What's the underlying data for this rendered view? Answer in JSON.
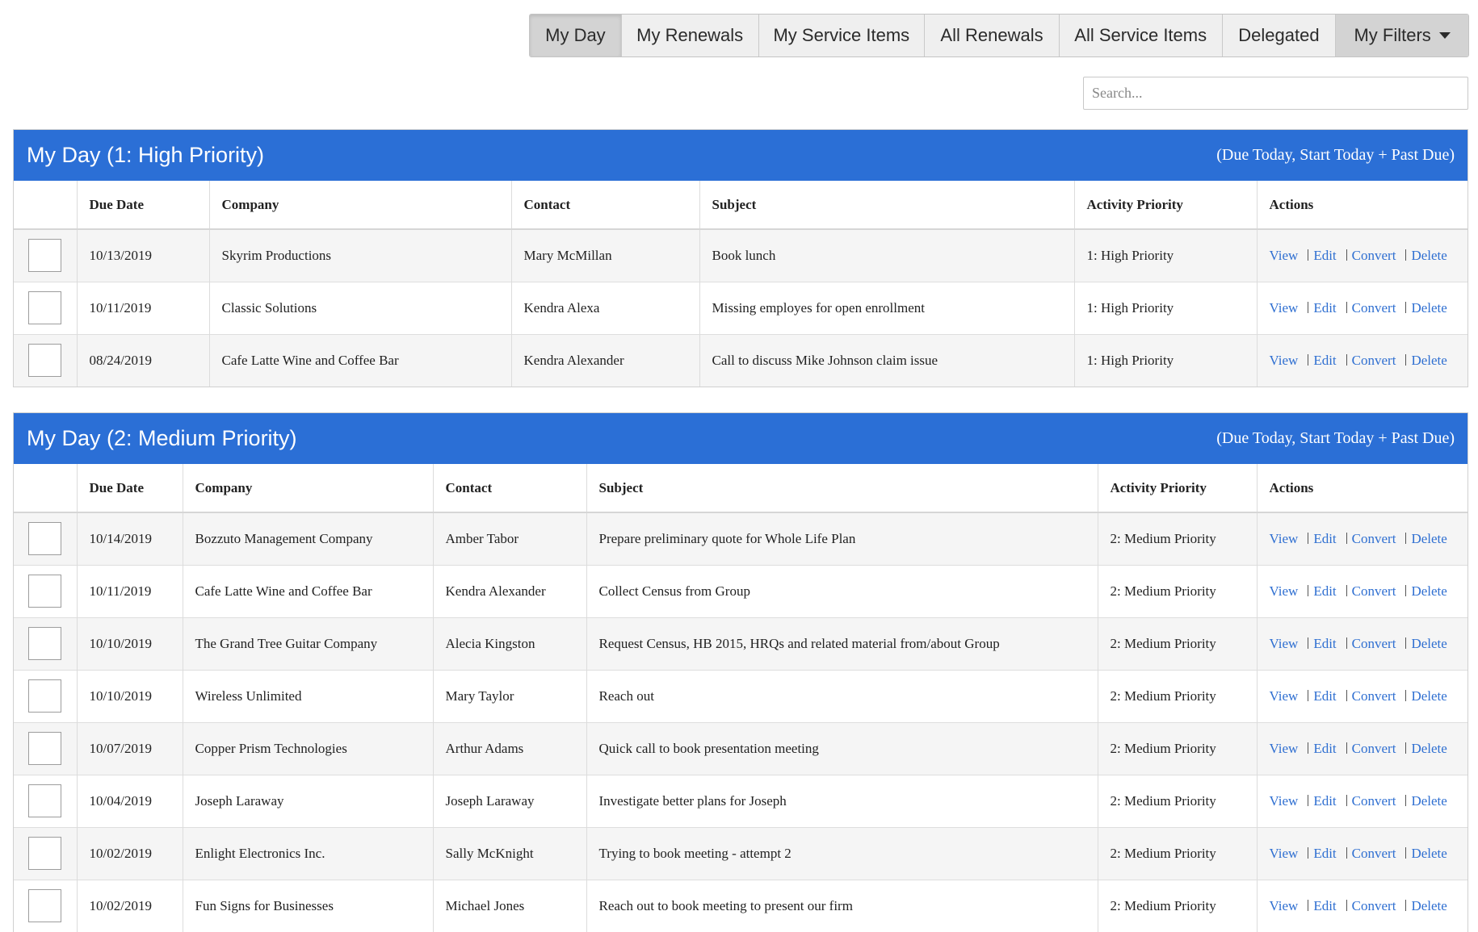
{
  "tabs": [
    {
      "label": "My Day",
      "active": true
    },
    {
      "label": "My Renewals",
      "active": false
    },
    {
      "label": "My Service Items",
      "active": false
    },
    {
      "label": "All Renewals",
      "active": false
    },
    {
      "label": "All Service Items",
      "active": false
    },
    {
      "label": "Delegated",
      "active": false
    },
    {
      "label": "My Filters",
      "active": false
    }
  ],
  "search": {
    "placeholder": "Search...",
    "value": ""
  },
  "columns": {
    "due_date": "Due Date",
    "company": "Company",
    "contact": "Contact",
    "subject": "Subject",
    "priority": "Activity Priority",
    "actions": "Actions"
  },
  "actions": {
    "view": "View",
    "edit": "Edit",
    "convert": "Convert",
    "delete": "Delete"
  },
  "sections": [
    {
      "title": "My Day (1: High Priority)",
      "note": "(Due Today, Start Today + Past Due)",
      "rows": [
        {
          "due_date": "10/13/2019",
          "company": "Skyrim Productions",
          "contact": "Mary McMillan",
          "subject": "Book lunch",
          "priority": "1: High Priority"
        },
        {
          "due_date": "10/11/2019",
          "company": "Classic Solutions",
          "contact": "Kendra Alexa",
          "subject": "Missing employes for open enrollment",
          "priority": "1: High Priority"
        },
        {
          "due_date": "08/24/2019",
          "company": "Cafe Latte Wine and Coffee Bar",
          "contact": "Kendra Alexander",
          "subject": "Call to discuss Mike Johnson claim issue",
          "priority": "1: High Priority"
        }
      ]
    },
    {
      "title": "My Day (2: Medium Priority)",
      "note": "(Due Today, Start Today + Past Due)",
      "rows": [
        {
          "due_date": "10/14/2019",
          "company": "Bozzuto Management Company",
          "contact": "Amber Tabor",
          "subject": "Prepare preliminary quote for Whole Life Plan",
          "priority": "2: Medium Priority"
        },
        {
          "due_date": "10/11/2019",
          "company": "Cafe Latte Wine and Coffee Bar",
          "contact": "Kendra Alexander",
          "subject": "Collect Census from Group",
          "priority": "2: Medium Priority"
        },
        {
          "due_date": "10/10/2019",
          "company": "The Grand Tree Guitar Company",
          "contact": "Alecia Kingston",
          "subject": "Request Census, HB 2015, HRQs and related material from/about Group",
          "priority": "2: Medium Priority"
        },
        {
          "due_date": "10/10/2019",
          "company": "Wireless Unlimited",
          "contact": "Mary Taylor",
          "subject": "Reach out",
          "priority": "2: Medium Priority"
        },
        {
          "due_date": "10/07/2019",
          "company": "Copper Prism Technologies",
          "contact": "Arthur Adams",
          "subject": "Quick call to book presentation meeting",
          "priority": "2: Medium Priority"
        },
        {
          "due_date": "10/04/2019",
          "company": "Joseph Laraway",
          "contact": "Joseph Laraway",
          "subject": "Investigate better plans for Joseph",
          "priority": "2: Medium Priority"
        },
        {
          "due_date": "10/02/2019",
          "company": "Enlight Electronics Inc.",
          "contact": "Sally McKnight",
          "subject": "Trying to book meeting - attempt 2",
          "priority": "2: Medium Priority"
        },
        {
          "due_date": "10/02/2019",
          "company": "Fun Signs for Businesses",
          "contact": "Michael Jones",
          "subject": "Reach out to book meeting to present our firm",
          "priority": "2: Medium Priority"
        }
      ]
    }
  ]
}
